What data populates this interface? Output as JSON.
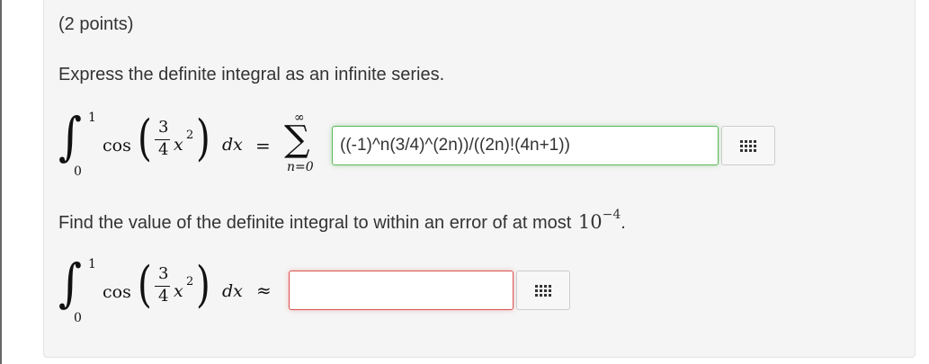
{
  "question": {
    "points": "(2 points)",
    "prompt1": "Express the definite integral as an infinite series.",
    "prompt2_text": "Find the value of the definite integral to within an error of at most",
    "prompt2_base": "10",
    "prompt2_exp": "−4",
    "prompt2_end": "."
  },
  "integral": {
    "lower": "0",
    "upper": "1",
    "func": "cos",
    "frac_num": "3",
    "frac_den": "4",
    "var": "x",
    "exponent": "2",
    "differential": "dx",
    "equals": "=",
    "approx": "≈"
  },
  "series": {
    "upper": "∞",
    "lower": "n=0",
    "sigma": "∑"
  },
  "answers": {
    "series_answer": "((-1)^n(3/4)^(2n))/((2n)!(4n+1))",
    "value_answer": ""
  },
  "icons": {
    "keyboard": "math-keyboard-icon"
  },
  "colors": {
    "valid_border": "#5cb85c",
    "invalid_border": "#d9534f",
    "panel_bg": "#f5f5f5"
  }
}
